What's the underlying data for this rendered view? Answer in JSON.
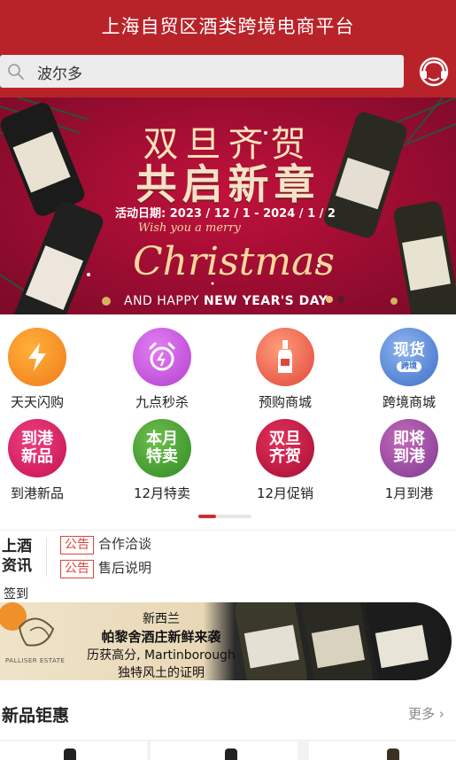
{
  "header": {
    "title": "上海自贸区酒类跨境电商平台",
    "search_value": "波尔多"
  },
  "banner": {
    "headline": "双旦齐贺",
    "subheadline": "共启新章",
    "date_text": "活动日期: 2023 / 12 / 1 - 2024 / 1 / 2",
    "script_small": "Wish you a merry",
    "script": "Christmas",
    "footer_left": "AND HAPPY ",
    "footer_right": "NEW YEAR'S DAY"
  },
  "grid": {
    "items": [
      {
        "label": "天天闪购",
        "icon_text": "",
        "icon": "lightning-icon"
      },
      {
        "label": "九点秒杀",
        "icon_text": "",
        "icon": "alarm-clock-icon"
      },
      {
        "label": "预购商城",
        "icon_text": "",
        "icon": "wine-bottle-icon"
      },
      {
        "label": "跨境商城",
        "icon_text": "现货",
        "icon_sub": "跨境",
        "icon": "cross-border-icon"
      },
      {
        "label": "到港新品",
        "icon_text": "到港\n新品",
        "icon": "new-arrival-icon"
      },
      {
        "label": "12月特卖",
        "icon_text": "本月\n特卖",
        "icon": "monthly-sale-icon"
      },
      {
        "label": "12月促销",
        "icon_text": "双旦\n齐贺",
        "icon": "holiday-promo-icon"
      },
      {
        "label": "1月到港",
        "icon_text": "即将\n到港",
        "icon": "arriving-soon-icon"
      }
    ]
  },
  "news": {
    "title": "上酒资讯",
    "rows": [
      {
        "tag": "公告",
        "text": "合作洽谈"
      },
      {
        "tag": "公告",
        "text": "售后说明"
      }
    ]
  },
  "checkin_label": "签到",
  "ad": {
    "line1": "新西兰",
    "line2": "帕黎舍酒庄新鲜来袭",
    "line3": "历获高分, Martinborough",
    "line4": "独特风土的证明",
    "estate": "PALLISER ESTATE"
  },
  "new_products": {
    "title": "新品钜惠",
    "more": "更多"
  },
  "colors": {
    "header_red": "#b8232a",
    "accent": "#c9312c"
  }
}
